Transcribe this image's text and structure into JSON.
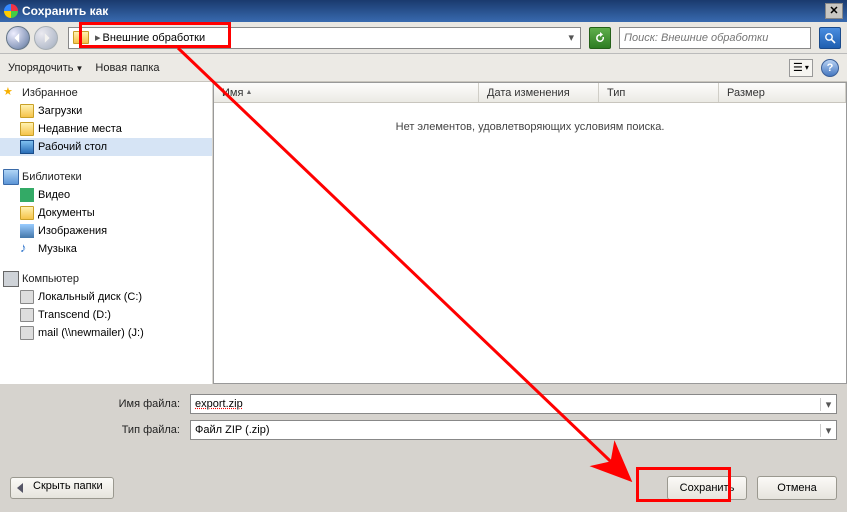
{
  "title": "Сохранить как",
  "breadcrumb_path": "Внешние обработки",
  "search_placeholder": "Поиск: Внешние обработки",
  "toolbar": {
    "organize": "Упорядочить",
    "new_folder": "Новая папка"
  },
  "sidebar": {
    "favorites": {
      "label": "Избранное",
      "items": [
        "Загрузки",
        "Недавние места",
        "Рабочий стол"
      ]
    },
    "libraries": {
      "label": "Библиотеки",
      "items": [
        "Видео",
        "Документы",
        "Изображения",
        "Музыка"
      ]
    },
    "computer": {
      "label": "Компьютер",
      "items": [
        "Локальный диск (C:)",
        "Transcend (D:)",
        "mail (\\\\newmailer) (J:)"
      ]
    }
  },
  "columns": {
    "name": "Имя",
    "date": "Дата изменения",
    "type": "Тип",
    "size": "Размер"
  },
  "empty_message": "Нет элементов, удовлетворяющих условиям поиска.",
  "form": {
    "filename_label": "Имя файла:",
    "filename_value": "export.zip",
    "filetype_label": "Тип файла:",
    "filetype_value": "Файл ZIP (.zip)"
  },
  "buttons": {
    "hide": "Скрыть папки",
    "save": "Сохранить",
    "cancel": "Отмена"
  }
}
